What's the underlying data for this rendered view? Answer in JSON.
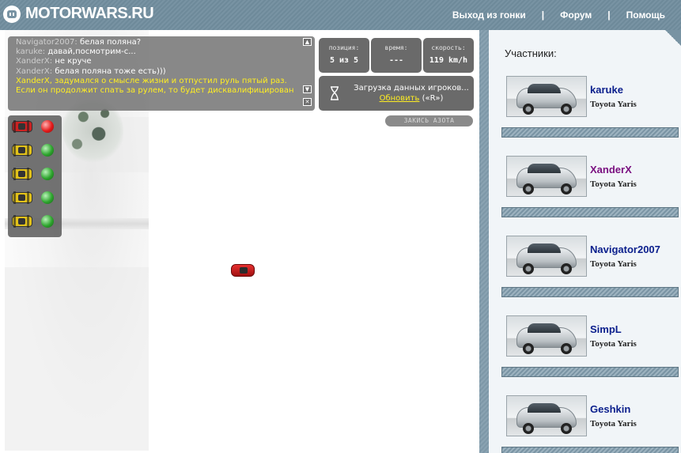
{
  "header": {
    "logo_text": "MOTORWARS.RU",
    "nav": [
      {
        "label": "Выход из гонки"
      },
      {
        "label": "Форум"
      },
      {
        "label": "Помощь"
      }
    ],
    "separator": "|"
  },
  "chat": {
    "lines": [
      {
        "nick": "Navigator2007:",
        "msg": "белая поляна?"
      },
      {
        "nick": "karuke:",
        "msg": "давай,посмотрим-с..."
      },
      {
        "nick": "XanderX:",
        "msg": "не круче"
      },
      {
        "nick": "XanderX:",
        "msg": "белая поляна тоже есть)))"
      }
    ],
    "system_lines": [
      "XanderX, задумался о смысле жизни и отпустил руль пятый раз.",
      "Если он продолжит спать за рулем, то будет дисквалифицирован."
    ],
    "scroll_up": "▲",
    "scroll_down": "▼",
    "close": "✕"
  },
  "stats": {
    "position_label": "позиция:",
    "position_value": "5 из 5",
    "time_label": "время:",
    "time_value": "---",
    "speed_label": "скорость:",
    "speed_value": "119 km/h"
  },
  "loading": {
    "text": "Загрузка данных игроков...",
    "refresh_link": "Обновить",
    "refresh_hint": "(«R»)"
  },
  "nitro_label": "ЗАКИСЬ АЗОТА",
  "racers_lights": [
    {
      "car_color": "#cc2222",
      "light": "red"
    },
    {
      "car_color": "#e2c21a",
      "light": "green"
    },
    {
      "car_color": "#e2c21a",
      "light": "green"
    },
    {
      "car_color": "#e2c21a",
      "light": "green"
    },
    {
      "car_color": "#e2c21a",
      "light": "green"
    }
  ],
  "sidebar": {
    "title": "Участники:",
    "players": [
      {
        "name": "karuke",
        "car": "Toyota Yaris",
        "name_color": "#0a1e8c"
      },
      {
        "name": "XanderX",
        "car": "Toyota Yaris",
        "name_color": "#7a1080"
      },
      {
        "name": "Navigator2007",
        "car": "Toyota Yaris",
        "name_color": "#0a1e8c"
      },
      {
        "name": "SimpL",
        "car": "Toyota Yaris",
        "name_color": "#0a1e8c"
      },
      {
        "name": "Geshkin",
        "car": "Toyota Yaris",
        "name_color": "#0a1e8c"
      }
    ]
  }
}
